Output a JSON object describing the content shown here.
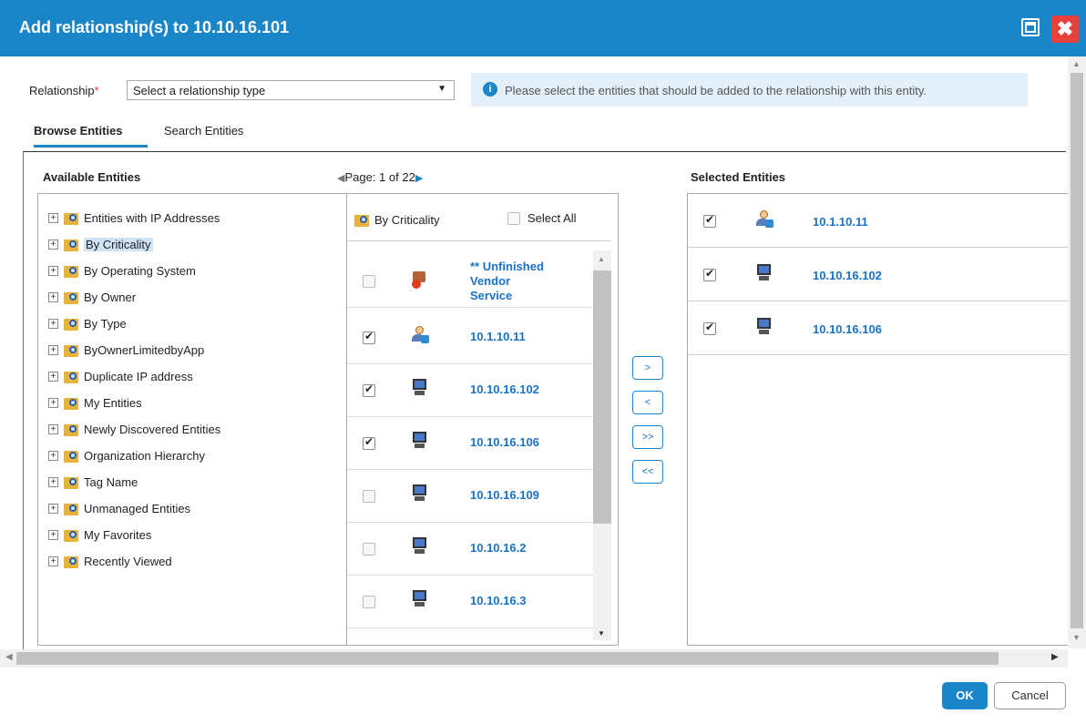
{
  "dialog": {
    "title": "Add relationship(s) to 10.10.16.101",
    "maximize_icon": "maximize-icon",
    "close_icon": "close-icon",
    "accent_color": "#1a86c8",
    "close_color": "#e8413c"
  },
  "relationship": {
    "label": "Relationship",
    "required_mark": "*",
    "select_value": "Select a relationship type",
    "arrow": "▼"
  },
  "info": {
    "icon": "info-icon",
    "icon_glyph": "i",
    "text": "Please select the entities that should be added to the relationship with this entity."
  },
  "tabs": [
    {
      "label": "Browse Entities",
      "active": true
    },
    {
      "label": "Search Entities",
      "active": false
    }
  ],
  "available": {
    "header": "Available Entities",
    "pager": {
      "prev": "◀",
      "text": "Page: 1 of 22",
      "next": "▶"
    },
    "tree": [
      {
        "label": "Entities with IP Addresses",
        "expander": "+",
        "selected": false
      },
      {
        "label": "By Criticality",
        "expander": "+",
        "selected": true
      },
      {
        "label": "By Operating System",
        "expander": "+",
        "selected": false
      },
      {
        "label": "By Owner",
        "expander": "+",
        "selected": false
      },
      {
        "label": "By Type",
        "expander": "+",
        "selected": false
      },
      {
        "label": "ByOwnerLimitedbyApp",
        "expander": "+",
        "selected": false
      },
      {
        "label": "Duplicate IP address",
        "expander": "+",
        "selected": false
      },
      {
        "label": "My Entities",
        "expander": "+",
        "selected": false
      },
      {
        "label": "Newly Discovered Entities",
        "expander": "+",
        "selected": false
      },
      {
        "label": "Organization Hierarchy",
        "expander": "+",
        "selected": false
      },
      {
        "label": "Tag Name",
        "expander": "+",
        "selected": false
      },
      {
        "label": "Unmanaged Entities",
        "expander": "+",
        "selected": false
      },
      {
        "label": "My Favorites",
        "expander": "+",
        "selected": false
      },
      {
        "label": "Recently Viewed",
        "expander": "+",
        "selected": false
      }
    ],
    "list": {
      "title": "By Criticality",
      "select_all": "Select All",
      "items": [
        {
          "line1": "** Unfinished",
          "line2": "Vendor",
          "line3": "Service",
          "checked": false,
          "icon": "vendor-service-icon"
        },
        {
          "label": "10.1.10.11",
          "checked": true,
          "icon": "user-entity-icon"
        },
        {
          "label": "10.10.16.102",
          "checked": true,
          "icon": "computer-icon"
        },
        {
          "label": "10.10.16.106",
          "checked": true,
          "icon": "computer-icon"
        },
        {
          "label": "10.10.16.109",
          "checked": false,
          "icon": "computer-icon"
        },
        {
          "label": "10.10.16.2",
          "checked": false,
          "icon": "computer-icon"
        },
        {
          "label": "10.10.16.3",
          "checked": false,
          "icon": "computer-icon"
        }
      ]
    }
  },
  "move_buttons": {
    "add": ">",
    "remove": "<",
    "add_all": ">>",
    "remove_all": "<<"
  },
  "selected": {
    "header": "Selected Entities",
    "items": [
      {
        "label": "10.1.10.11",
        "checked": true,
        "icon": "user-entity-icon"
      },
      {
        "label": "10.10.16.102",
        "checked": true,
        "icon": "computer-icon"
      },
      {
        "label": "10.10.16.106",
        "checked": true,
        "icon": "computer-icon"
      }
    ]
  },
  "footer": {
    "ok": "OK",
    "cancel": "Cancel"
  }
}
